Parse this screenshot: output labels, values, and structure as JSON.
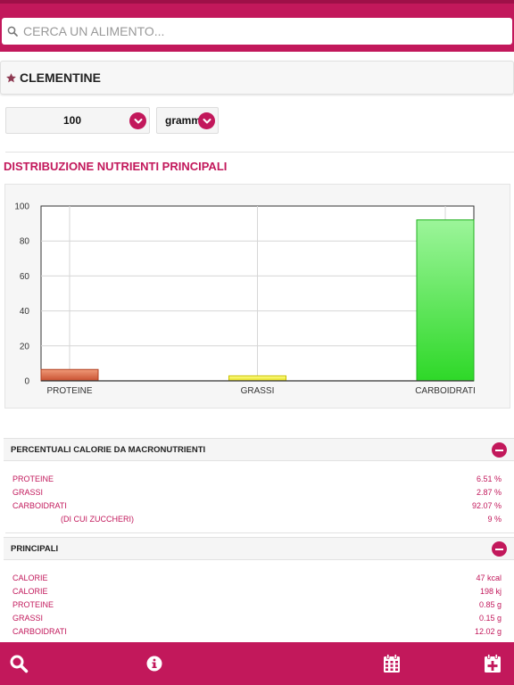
{
  "search": {
    "placeholder": "CERCA UN ALIMENTO..."
  },
  "food": {
    "name": "CLEMENTINE"
  },
  "quantity": {
    "value": "100",
    "unit": "grammi"
  },
  "section_title": "DISTRIBUZIONE NUTRIENTI PRINCIPALI",
  "chart_data": {
    "type": "bar",
    "categories": [
      "PROTEINE",
      "GRASSI",
      "CARBOIDRATI"
    ],
    "values": [
      6.51,
      2.87,
      92.07
    ],
    "colors": [
      "#e07050",
      "#f5f040",
      "#3ee03a"
    ],
    "title": "",
    "xlabel": "",
    "ylabel": "",
    "ylim": [
      0,
      100
    ],
    "yticks": [
      "0",
      "20",
      "40",
      "60",
      "80",
      "100"
    ],
    "grid": true
  },
  "macro_percent": {
    "title": "PERCENTUALI CALORIE DA MACRONUTRIENTI",
    "rows": [
      {
        "label": "PROTEINE",
        "value": "6.51 %"
      },
      {
        "label": "GRASSI",
        "value": "2.87 %"
      },
      {
        "label": "CARBOIDRATI",
        "value": "92.07 %"
      },
      {
        "label": "(DI CUI ZUCCHERI)",
        "value": "9 %"
      }
    ]
  },
  "principali": {
    "title": "PRINCIPALI",
    "rows": [
      {
        "label": "CALORIE",
        "value": "47 kcal"
      },
      {
        "label": "CALORIE",
        "value": "198 kj"
      },
      {
        "label": "PROTEINE",
        "value": "0.85 g"
      },
      {
        "label": "GRASSI",
        "value": "0.15 g"
      },
      {
        "label": "CARBOIDRATI",
        "value": "12.02 g"
      }
    ]
  },
  "icons": {
    "search": "search-icon",
    "star": "star-icon",
    "chevron": "chevron-down-icon",
    "collapse": "minus-circle-icon",
    "info": "info-icon",
    "calendar": "calendar-icon",
    "calendar_add": "calendar-add-icon"
  },
  "colors": {
    "accent": "#c2185b",
    "label": "#c2185b"
  }
}
